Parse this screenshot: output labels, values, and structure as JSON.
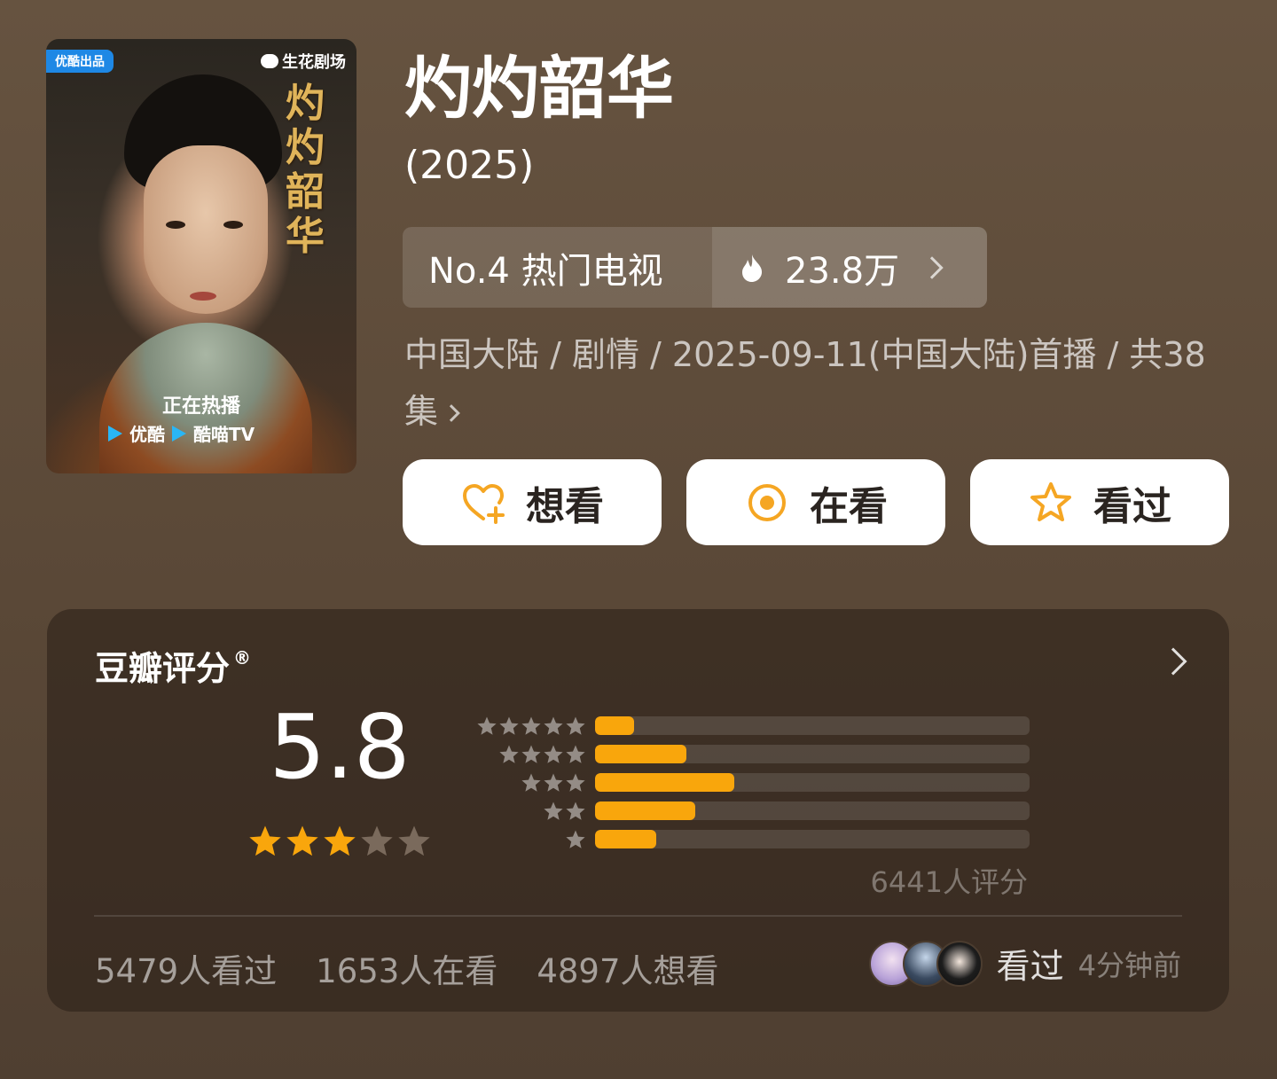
{
  "poster": {
    "badge_left": "优酷出品",
    "badge_right": "生花剧场",
    "vertical_title": "灼灼韶华",
    "now_playing": "正在热播",
    "platforms": [
      "优酷",
      "酷喵TV"
    ]
  },
  "header": {
    "title": "灼灼韶华",
    "year": "(2025)"
  },
  "rank": {
    "label": "No.4 热门电视",
    "heat": "23.8万"
  },
  "meta": {
    "text": "中国大陆 / 剧情 / 2025-09-11(中国大陆)首播 / 共38集"
  },
  "actions": {
    "want": "想看",
    "watching": "在看",
    "watched": "看过"
  },
  "rating": {
    "title": "豆瓣评分",
    "reg": "®",
    "score": "5.8",
    "stars_filled": 3,
    "distribution": [
      {
        "stars": 5,
        "fraction": 0.09
      },
      {
        "stars": 4,
        "fraction": 0.21
      },
      {
        "stars": 3,
        "fraction": 0.32
      },
      {
        "stars": 2,
        "fraction": 0.23
      },
      {
        "stars": 1,
        "fraction": 0.14
      }
    ],
    "votes": "6441人评分"
  },
  "stats": {
    "watched": "5479人看过",
    "watching": "1653人在看",
    "want": "4897人想看"
  },
  "friends": {
    "label": "看过",
    "time": "4分钟前"
  },
  "colors": {
    "accent": "#f9a60c",
    "background": "#5e4c3a"
  }
}
